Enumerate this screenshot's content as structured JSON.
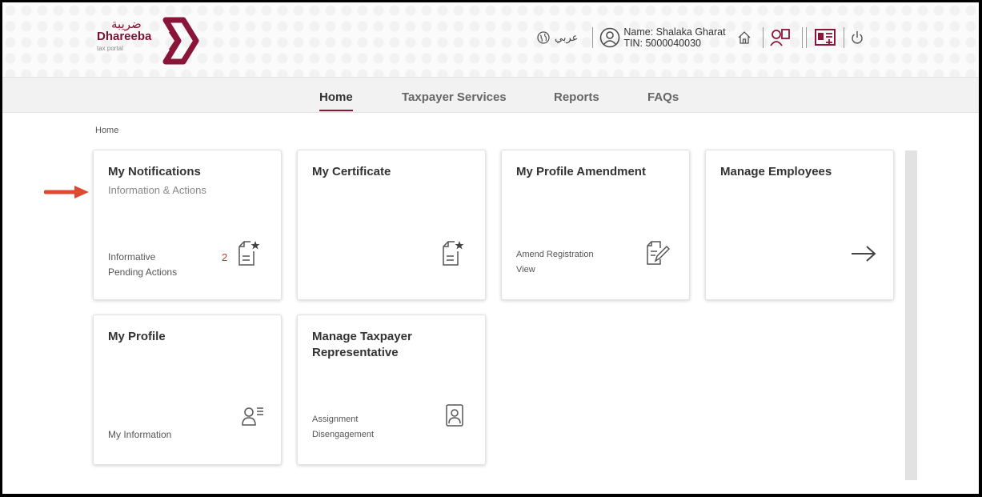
{
  "header": {
    "logo_arabic": "ضريبة",
    "logo_brand": "Dhareeba",
    "logo_tagline": "tax portal",
    "language_toggle": "عربي",
    "user_name": "Name: Shalaka Gharat",
    "user_tin": "TIN: 5000040030",
    "icons": [
      "globe-icon",
      "user-circle-icon",
      "home-icon",
      "users-icon",
      "id-card-icon",
      "power-icon"
    ]
  },
  "nav": {
    "items": [
      "Home",
      "Taxpayer Services",
      "Reports",
      "FAQs"
    ],
    "active": "Home"
  },
  "breadcrumb": "Home",
  "cards": {
    "notifications": {
      "title": "My Notifications",
      "subtitle": "Information & Actions",
      "line1": "Informative",
      "line2": "Pending Actions",
      "count": "2"
    },
    "certificate": {
      "title": "My Certificate"
    },
    "amendment": {
      "title": "My Profile Amendment",
      "line1": "Amend Registration",
      "line2": "View"
    },
    "employees": {
      "title": "Manage Employees"
    },
    "profile": {
      "title": "My Profile",
      "line1": "My Information"
    },
    "representative": {
      "title": "Manage Taxpayer Representative",
      "line1": "Assignment",
      "line2": "Disengagement"
    }
  },
  "colors": {
    "brand": "#8a1538",
    "arrow": "#e0482f"
  }
}
